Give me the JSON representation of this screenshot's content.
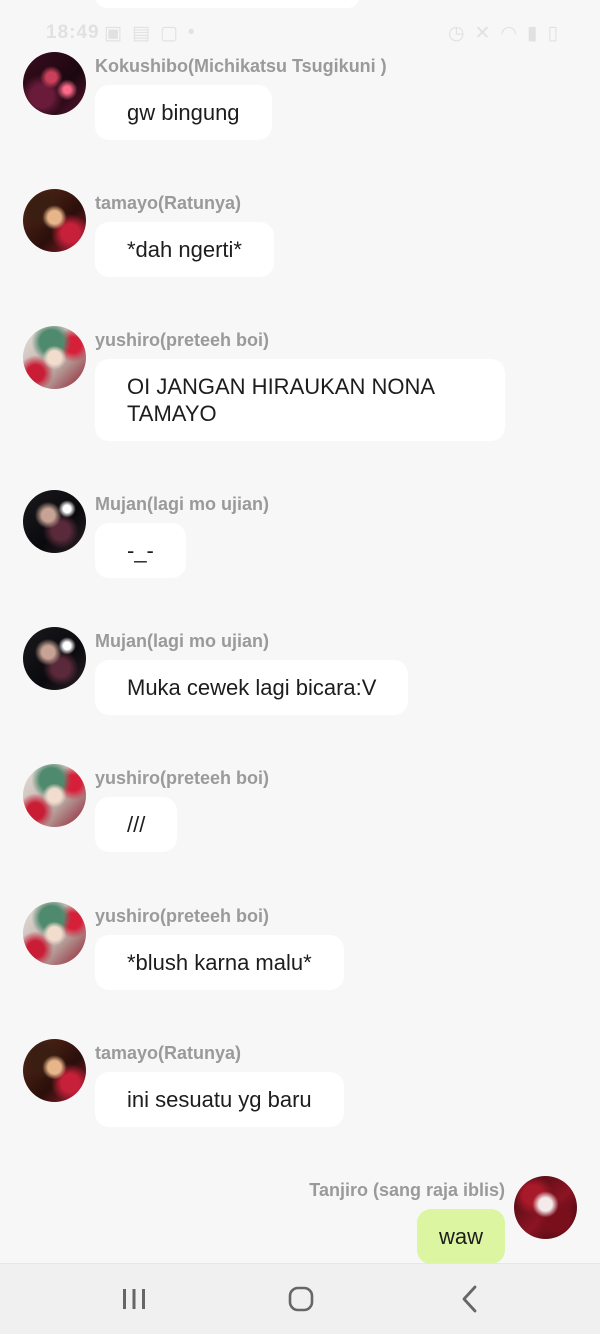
{
  "status_bar": {
    "time": "18:49"
  },
  "messages": [
    {
      "sender": "Kokushibo(Michikatsu Tsugikuni )",
      "text": "gw bingung",
      "avatar": "kokushibo-avatar"
    },
    {
      "sender": "tamayo(Ratunya)",
      "text": "*dah ngerti*",
      "avatar": "tamayo-avatar"
    },
    {
      "sender": "yushiro(preteeh boi)",
      "text": "OI JANGAN HIRAUKAN NONA TAMAYO",
      "avatar": "yushiro-avatar"
    },
    {
      "sender": "Mujan(lagi mo ujian)",
      "text": "-_-",
      "avatar": "mujan-avatar"
    },
    {
      "sender": "Mujan(lagi mo ujian)",
      "text": "Muka cewek lagi bicara:V",
      "avatar": "mujan-avatar"
    },
    {
      "sender": "yushiro(preteeh boi)",
      "text": "///",
      "avatar": "yushiro-avatar"
    },
    {
      "sender": "yushiro(preteeh boi)",
      "text": "*blush karna malu*",
      "avatar": "yushiro-avatar"
    },
    {
      "sender": "tamayo(Ratunya)",
      "text": "ini sesuatu yg baru",
      "avatar": "tamayo-avatar"
    },
    {
      "sender": "Tanjiro (sang raja iblis)",
      "text": "waw",
      "avatar": "tanjiro-avatar",
      "own": true
    }
  ],
  "nav": {
    "recents_icon": "recents-icon",
    "home_icon": "home-icon",
    "back_icon": "back-icon"
  },
  "colors": {
    "background": "#f7f7f7",
    "bubble": "#ffffff",
    "own_bubble": "#dcf5a0",
    "sender_text": "#9a9a9a",
    "message_text": "#1d1d1d"
  }
}
